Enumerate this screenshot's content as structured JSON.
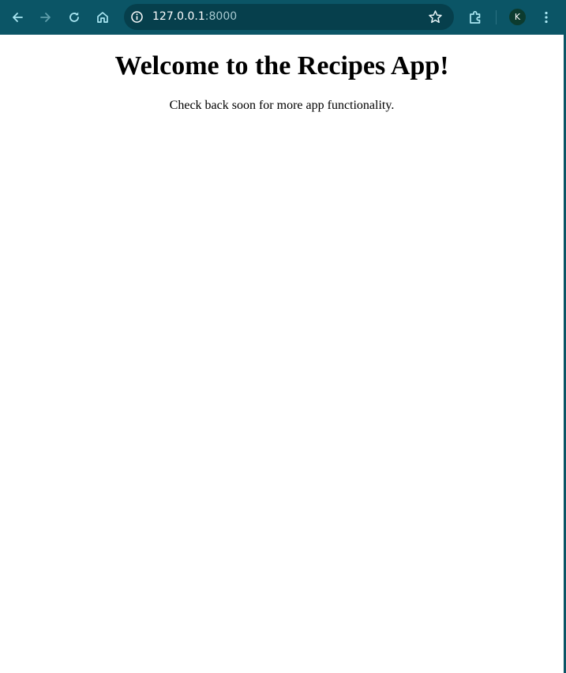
{
  "browser": {
    "url_host": "127.0.0.1",
    "url_port": ":8000",
    "profile_initial": "K",
    "colors": {
      "toolbar": "#0b5566",
      "omnibox": "#063f4c",
      "icon": "#a9e6f2",
      "avatar": "#0c3b2e"
    },
    "icons": {
      "back": "arrow-left-icon",
      "forward": "arrow-right-icon",
      "reload": "reload-icon",
      "home": "home-icon",
      "site_info": "info-icon",
      "bookmark": "star-icon",
      "extensions": "puzzle-icon",
      "menu": "kebab-menu-icon"
    }
  },
  "page": {
    "heading": "Welcome to the Recipes App!",
    "message": "Check back soon for more app functionality."
  }
}
